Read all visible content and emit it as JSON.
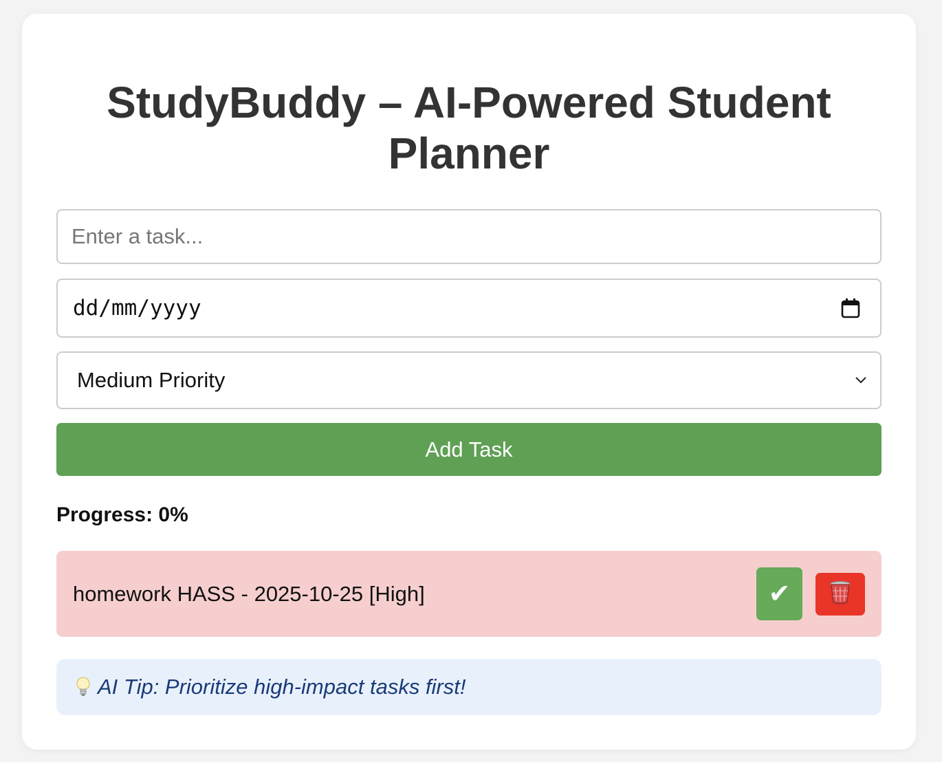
{
  "app": {
    "title": "StudyBuddy – AI-Powered Student Planner"
  },
  "form": {
    "task_placeholder": "Enter a task...",
    "task_value": "",
    "date_placeholder": "dd/mm/yyyy",
    "priority_selected": "Medium Priority",
    "add_button_label": "Add Task"
  },
  "progress": {
    "label": "Progress: 0%"
  },
  "tasks": [
    {
      "text": "homework HASS - 2025-10-25 [High]",
      "complete_label": "✔",
      "delete_icon": "trash-icon"
    }
  ],
  "tip": {
    "icon": "lightbulb-icon",
    "text": "AI Tip: Prioritize high-impact tasks first!"
  },
  "colors": {
    "add_button": "#5fa055",
    "task_high_bg": "#f6cece",
    "complete_button": "#66aa5a",
    "delete_button": "#e93428",
    "tip_bg": "#e8f1fb",
    "tip_text": "#1a3a78"
  }
}
